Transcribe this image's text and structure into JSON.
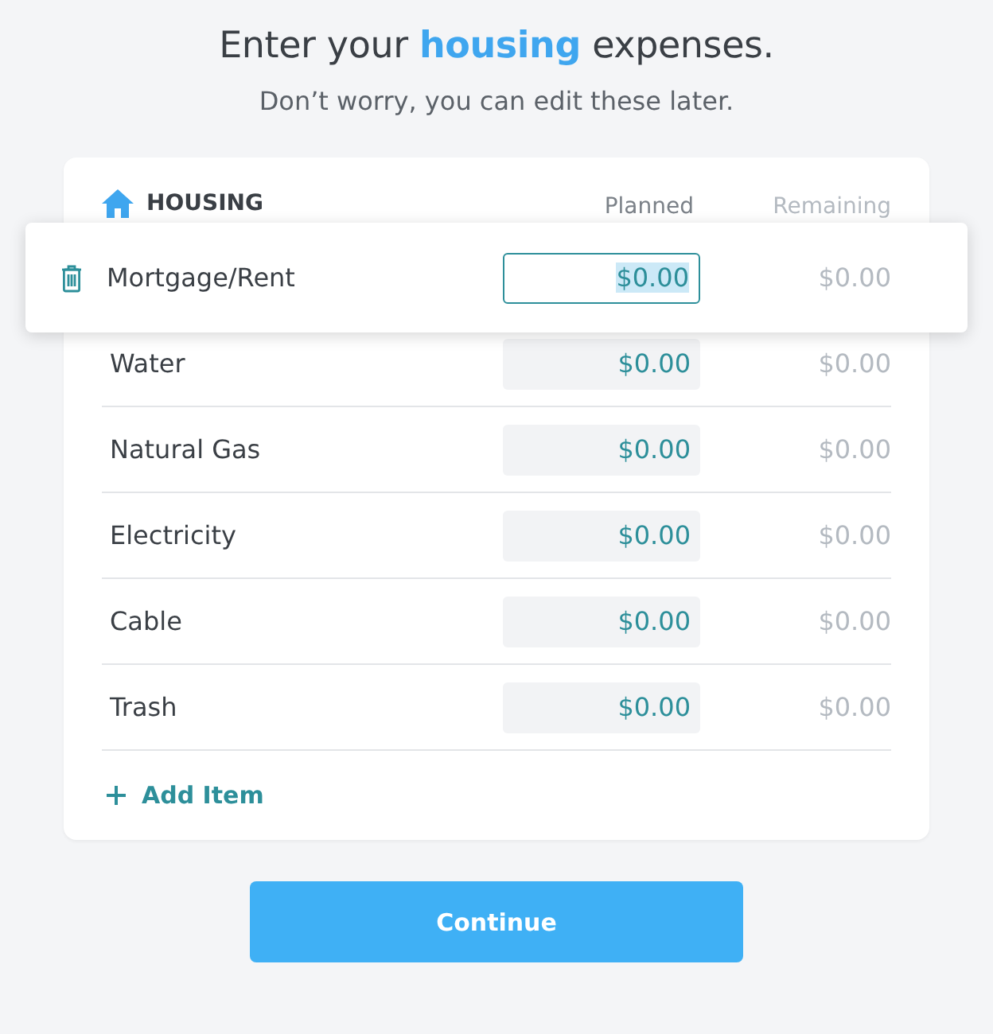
{
  "heading": "Enter your **housing** expenses.",
  "subheading": "Don’t worry, you can edit these later.",
  "category": {
    "name": "HOUSING",
    "columns": [
      "Planned",
      "Remaining"
    ],
    "items": [
      {
        "name": "Mortgage/Rent",
        "planned": "$0.00",
        "remaining": "$0.00",
        "selected": true
      },
      {
        "name": "Water",
        "planned": "$0.00",
        "remaining": "$0.00",
        "selected": false
      },
      {
        "name": "Natural Gas",
        "planned": "$0.00",
        "remaining": "$0.00",
        "selected": false
      },
      {
        "name": "Electricity",
        "planned": "$0.00",
        "remaining": "$0.00",
        "selected": false
      },
      {
        "name": "Cable",
        "planned": "$0.00",
        "remaining": "$0.00",
        "selected": false
      },
      {
        "name": "Trash",
        "planned": "$0.00",
        "remaining": "$0.00",
        "selected": false
      }
    ],
    "add_item": "Add Item"
  },
  "continue_button": "Continue"
}
